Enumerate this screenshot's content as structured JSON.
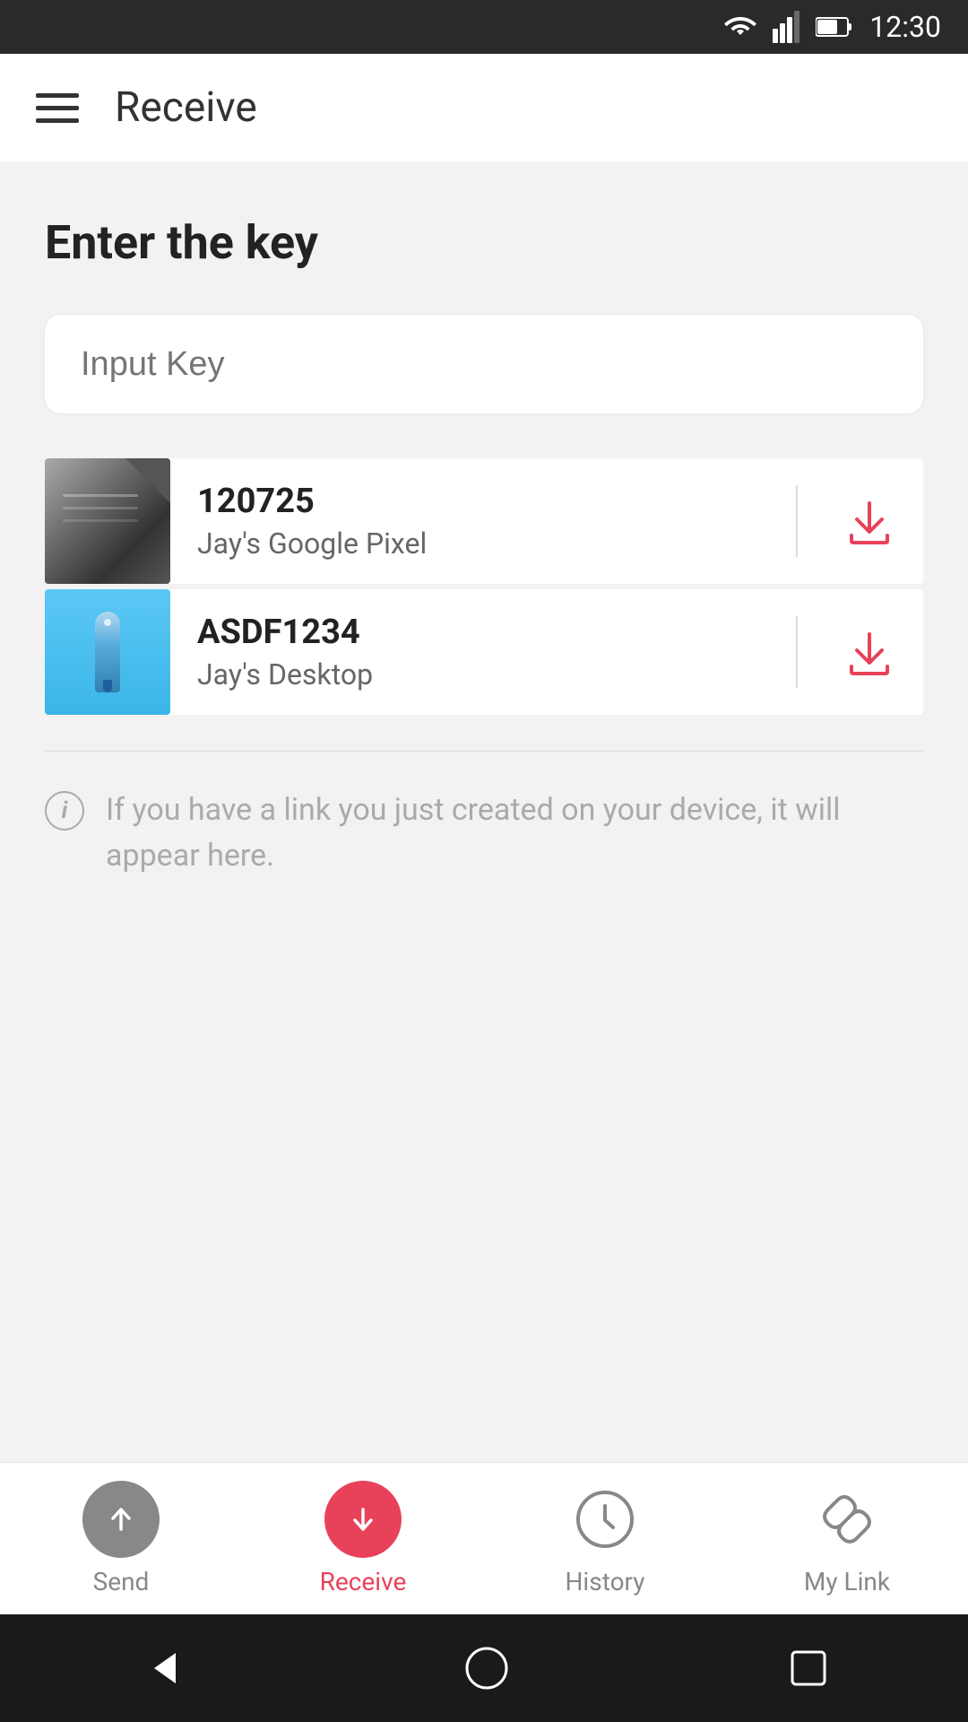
{
  "statusBar": {
    "time": "12:30"
  },
  "appBar": {
    "title": "Receive"
  },
  "main": {
    "sectionTitle": "Enter the key",
    "inputPlaceholder": "Input Key",
    "items": [
      {
        "key": "120725",
        "device": "Jay's Google Pixel",
        "thumbType": "pixel"
      },
      {
        "key": "ASDF1234",
        "device": "Jay's Desktop",
        "thumbType": "desktop"
      }
    ],
    "infoText": "If you have a link you just created on your device, it will appear here."
  },
  "bottomNav": {
    "items": [
      {
        "label": "Send",
        "active": false,
        "icon": "send"
      },
      {
        "label": "Receive",
        "active": true,
        "icon": "receive"
      },
      {
        "label": "History",
        "active": false,
        "icon": "history"
      },
      {
        "label": "My Link",
        "active": false,
        "icon": "link"
      }
    ]
  }
}
